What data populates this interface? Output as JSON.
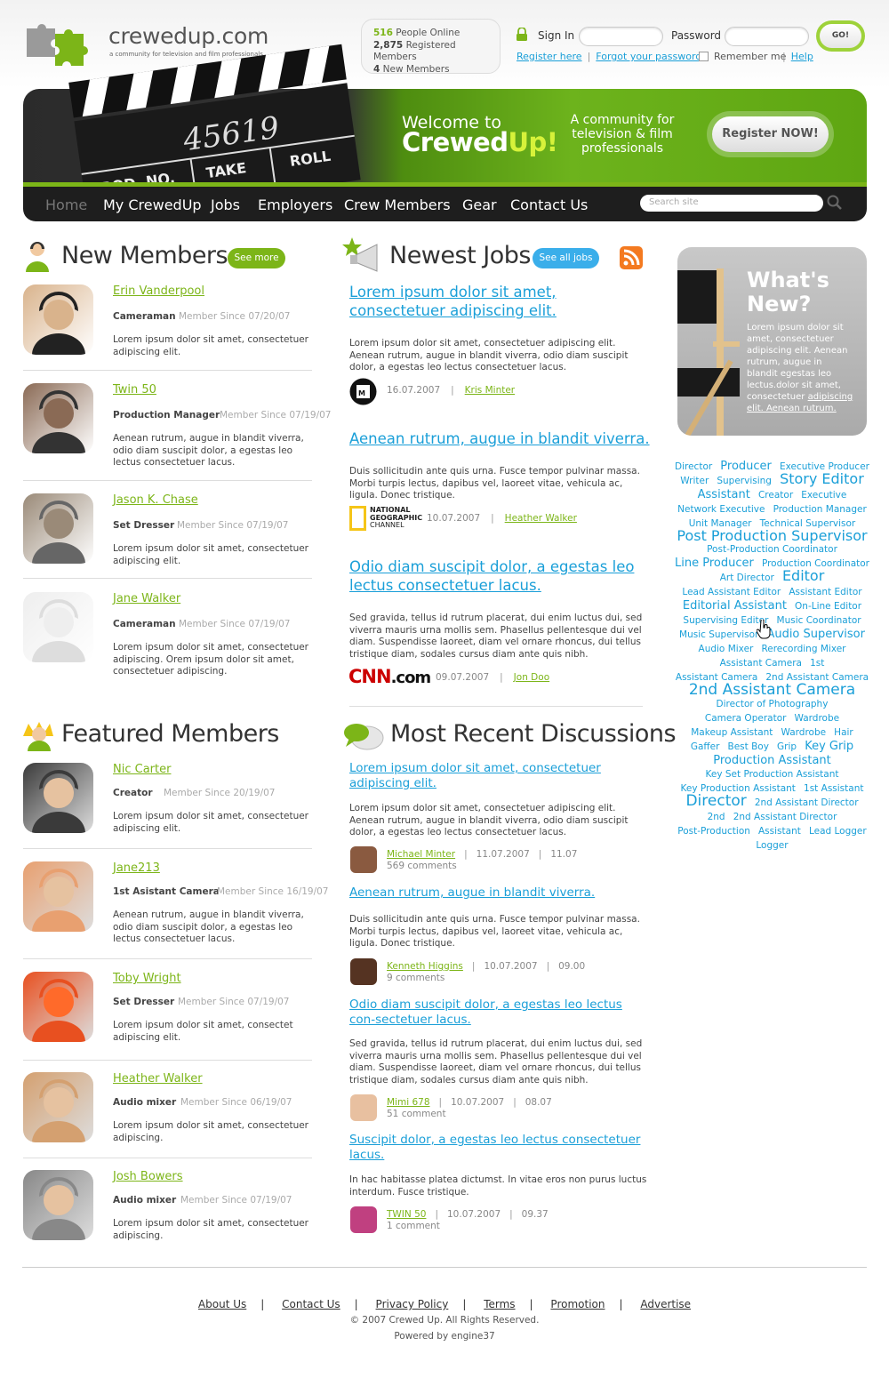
{
  "brand": {
    "name": "crewedup.com",
    "tagline": "a community for television and film professionals"
  },
  "stats": {
    "online_count": "516",
    "online_label": "People Online",
    "registered_count": "2,875",
    "registered_label": "Registered Members",
    "new_count": "4",
    "new_label": "New Members"
  },
  "login": {
    "signin_label": "Sign In",
    "password_label": "Password",
    "go_label": "GO!",
    "register_link": "Register here",
    "forgot_link": "Forgot your password?",
    "remember_label": "Remember me",
    "help_link": "Help"
  },
  "banner": {
    "welcome_line1": "Welcome to",
    "welcome_brand_1": "Crewed",
    "welcome_brand_2": "Up!",
    "community_text": "A community for television & film professionals",
    "register_button": "Register NOW!",
    "clapper_number": "45619",
    "clapper_prod": "PROD. NO.",
    "clapper_take": "TAKE",
    "clapper_roll": "ROLL"
  },
  "nav": {
    "items": [
      "Home",
      "My CrewedUp",
      "Jobs",
      "Employers",
      "Crew Members",
      "Gear",
      "Contact Us"
    ],
    "search_placeholder": "Search site"
  },
  "new_members": {
    "title": "New Members",
    "see_more": "See more",
    "items": [
      {
        "name": "Erin Vanderpool",
        "role": "Cameraman",
        "since": "Member Since 07/20/07",
        "desc": "Lorem ipsum dolor sit amet, consectetuer adipiscing elit."
      },
      {
        "name": "Twin 50",
        "role": "Production Manager",
        "since": "Member Since 07/19/07",
        "desc": "Aenean rutrum, augue in blandit viverra, odio diam suscipit dolor, a egestas leo lectus consectetuer lacus."
      },
      {
        "name": "Jason K. Chase",
        "role": "Set Dresser",
        "since": "Member Since 07/19/07",
        "desc": "Lorem ipsum dolor sit amet, consectetuer adipiscing elit."
      },
      {
        "name": "Jane Walker",
        "role": "Cameraman",
        "since": "Member Since 07/19/07",
        "desc": "Lorem ipsum dolor sit amet, consectetuer adipiscing. Orem ipsum dolor sit amet, consectetuer adipiscing."
      }
    ]
  },
  "featured_members": {
    "title": "Featured Members",
    "items": [
      {
        "name": "Nic Carter",
        "role": "Creator",
        "since": "Member Since 20/19/07",
        "desc": "Lorem ipsum dolor sit amet, consectetuer adipiscing elit."
      },
      {
        "name": "Jane213",
        "role": "1st Asistant Camera",
        "since": "Member Since 16/19/07",
        "desc": "Aenean rutrum, augue in blandit viverra, odio diam suscipit dolor, a egestas leo lectus consectetuer lacus."
      },
      {
        "name": "Toby Wright",
        "role": "Set Dresser",
        "since": "Member Since 07/19/07",
        "desc": "Lorem ipsum dolor sit amet, consectet adipiscing elit."
      },
      {
        "name": "Heather Walker",
        "role": "Audio mixer",
        "since": "Member Since 06/19/07",
        "desc": "Lorem ipsum dolor sit amet, consectetuer adipiscing."
      },
      {
        "name": "Josh Bowers",
        "role": "Audio mixer",
        "since": "Member Since 07/19/07",
        "desc": "Lorem ipsum dolor sit amet, consectetuer adipiscing."
      }
    ]
  },
  "newest_jobs": {
    "title": "Newest Jobs",
    "see_all": "See all jobs",
    "items": [
      {
        "title": "Lorem ipsum dolor sit amet, consectetuer adipiscing elit.",
        "desc": "Lorem ipsum dolor sit amet, consectetuer adipiscing elit. Aenean rutrum, augue in blandit viverra, odio diam suscipit dolor, a egestas leo lectus consectetuer lacus.",
        "date": "16.07.2007",
        "author": "Kris Minter",
        "logo": "mtv-logo"
      },
      {
        "title": "Aenean rutrum, augue in blandit viverra.",
        "desc": "Duis sollicitudin ante quis urna. Fusce tempor pulvinar massa. Morbi turpis lectus, dapibus vel, laoreet vitae, vehicula ac, ligula. Donec tristique.",
        "date": "10.07.2007",
        "author": "Heather Walker",
        "logo": "national-geographic-logo",
        "logo_text_1": "NATIONAL",
        "logo_text_2": "GEOGRAPHIC",
        "logo_text_3": "CHANNEL"
      },
      {
        "title": "Odio diam suscipit dolor, a egestas leo lectus consectetuer lacus.",
        "desc": "Sed gravida, tellus id rutrum placerat, dui enim luctus dui, sed viverra mauris urna mollis sem. Phasellus pellentesque dui vel diam. Suspendisse laoreet, diam vel ornare rhoncus, dui tellus tristique diam, sodales cursus diam ante quis nibh.",
        "date": "09.07.2007",
        "author": "Jon Doo",
        "logo": "cnn-logo",
        "logo_text": "CNN",
        "logo_suffix": ".com"
      }
    ]
  },
  "discussions": {
    "title": "Most Recent Discussions",
    "items": [
      {
        "title": "Lorem ipsum dolor sit amet, consectetuer adipiscing elit.",
        "desc": "Lorem ipsum dolor sit amet, consectetuer adipiscing elit. Aenean rutrum, augue in blandit viverra, odio diam suscipit dolor, a egestas leo lectus consectetuer lacus.",
        "author": "Michael Minter",
        "date": "11.07.2007",
        "time": "11.07",
        "comments": "569 comments"
      },
      {
        "title": "Aenean rutrum, augue in blandit viverra.",
        "desc": "Duis sollicitudin ante quis urna. Fusce tempor pulvinar massa. Morbi turpis lectus, dapibus vel, laoreet vitae, vehicula ac, ligula. Donec tristique.",
        "author": "Kenneth Higgins",
        "date": "10.07.2007",
        "time": "09.00",
        "comments": "9 comments"
      },
      {
        "title": "Odio diam suscipit dolor, a egestas leo lectus con-sectetuer lacus.",
        "desc": "Sed gravida, tellus id rutrum placerat, dui enim luctus dui, sed viverra mauris urna mollis sem. Phasellus pellentesque dui vel diam. Suspendisse laoreet, diam vel ornare rhoncus, dui tellus tristique diam, sodales cursus diam ante quis nibh.",
        "author": "Mimi 678",
        "date": "10.07.2007",
        "time": "08.07",
        "comments": "51 comment"
      },
      {
        "title": "Suscipit dolor, a egestas leo lectus consectetuer lacus.",
        "desc": "In hac habitasse platea dictumst. In vitae eros non purus luctus interdum. Fusce tristique.",
        "author": "TWIN 50",
        "date": "10.07.2007",
        "time": "09.37",
        "comments": "1 comment"
      }
    ]
  },
  "whats_new": {
    "title_1": "What's",
    "title_2": "New?",
    "text": "Lorem ipsum dolor sit amet, consectetuer adipiscing elit. Aenean rutrum, augue in blandit egestas leo lectus.dolor sit amet, consectetuer",
    "link": "adipiscing elit. Aenean rutrum."
  },
  "tag_cloud": [
    {
      "t": "Director",
      "s": "t1"
    },
    {
      "t": "Producer",
      "s": "t2"
    },
    {
      "t": "Executive Producer",
      "s": "t1"
    },
    {
      "t": "Writer",
      "s": "t1"
    },
    {
      "t": "Supervising",
      "s": "t1"
    },
    {
      "t": "Story Editor",
      "s": "t3"
    },
    {
      "t": "Assistant",
      "s": "t2"
    },
    {
      "t": "Creator",
      "s": "t1"
    },
    {
      "t": "Executive",
      "s": "t1"
    },
    {
      "t": "Network Executive",
      "s": "t1"
    },
    {
      "t": "Production Manager",
      "s": "t1"
    },
    {
      "t": "Unit Manager",
      "s": "t1"
    },
    {
      "t": "Technical Supervisor",
      "s": "t1"
    },
    {
      "t": "Post Production Supervisor",
      "s": "t3"
    },
    {
      "t": "Post-Production Coordinator",
      "s": "t1"
    },
    {
      "t": "Line Producer",
      "s": "t2"
    },
    {
      "t": "Production Coordinator",
      "s": "t1"
    },
    {
      "t": "Art Director",
      "s": "t1"
    },
    {
      "t": "Editor",
      "s": "t3"
    },
    {
      "t": "Lead Assistant Editor",
      "s": "t1"
    },
    {
      "t": "Assistant Editor",
      "s": "t1"
    },
    {
      "t": "Editorial Assistant",
      "s": "t2"
    },
    {
      "t": "On-Line Editor",
      "s": "t1"
    },
    {
      "t": "Supervising Editor",
      "s": "t1"
    },
    {
      "t": "Music Coordinator",
      "s": "t1"
    },
    {
      "t": "Music Supervisor",
      "s": "t1"
    },
    {
      "t": "Audio Supervisor",
      "s": "t2"
    },
    {
      "t": "Audio Mixer",
      "s": "t1"
    },
    {
      "t": "Rerecording Mixer",
      "s": "t1"
    },
    {
      "t": "Assistant Camera",
      "s": "t1"
    },
    {
      "t": "1st",
      "s": "t1"
    },
    {
      "t": "Assistant Camera",
      "s": "t1"
    },
    {
      "t": "2nd Assistant Camera",
      "s": "t1"
    },
    {
      "t": "2nd Assistant Camera",
      "s": "t4"
    },
    {
      "t": "Director of Photography",
      "s": "t1"
    },
    {
      "t": "Camera Operator",
      "s": "t1"
    },
    {
      "t": "Wardrobe",
      "s": "t1"
    },
    {
      "t": "Makeup Assistant",
      "s": "t1"
    },
    {
      "t": "Wardrobe",
      "s": "t1"
    },
    {
      "t": "Hair",
      "s": "t1"
    },
    {
      "t": "Gaffer",
      "s": "t1"
    },
    {
      "t": "Best Boy",
      "s": "t1"
    },
    {
      "t": "Grip",
      "s": "t1"
    },
    {
      "t": "Key Grip",
      "s": "t2"
    },
    {
      "t": "Production Assistant",
      "s": "t2"
    },
    {
      "t": "Key Set Production Assistant",
      "s": "t1"
    },
    {
      "t": "Key Production Assistant",
      "s": "t1"
    },
    {
      "t": "1st Assistant",
      "s": "t1"
    },
    {
      "t": "Director",
      "s": "t4"
    },
    {
      "t": "2nd Assistant Director",
      "s": "t1"
    },
    {
      "t": "2nd",
      "s": "t1"
    },
    {
      "t": "2nd Assistant Director",
      "s": "t1"
    },
    {
      "t": "Post-Production",
      "s": "t1"
    },
    {
      "t": "Assistant",
      "s": "t1"
    },
    {
      "t": "Lead Logger",
      "s": "t1"
    },
    {
      "t": "Logger",
      "s": "t1"
    }
  ],
  "footer": {
    "links": [
      "About Us",
      "Contact Us",
      "Privacy Policy",
      "Terms",
      "Promotion",
      "Advertise"
    ],
    "copyright": "© 2007 Crewed Up. All Rights Reserved.",
    "powered": "Powered by engine37"
  },
  "colors": {
    "green": "#7cb518",
    "blue": "#1a9fd8",
    "dark": "#1e1e1e"
  }
}
